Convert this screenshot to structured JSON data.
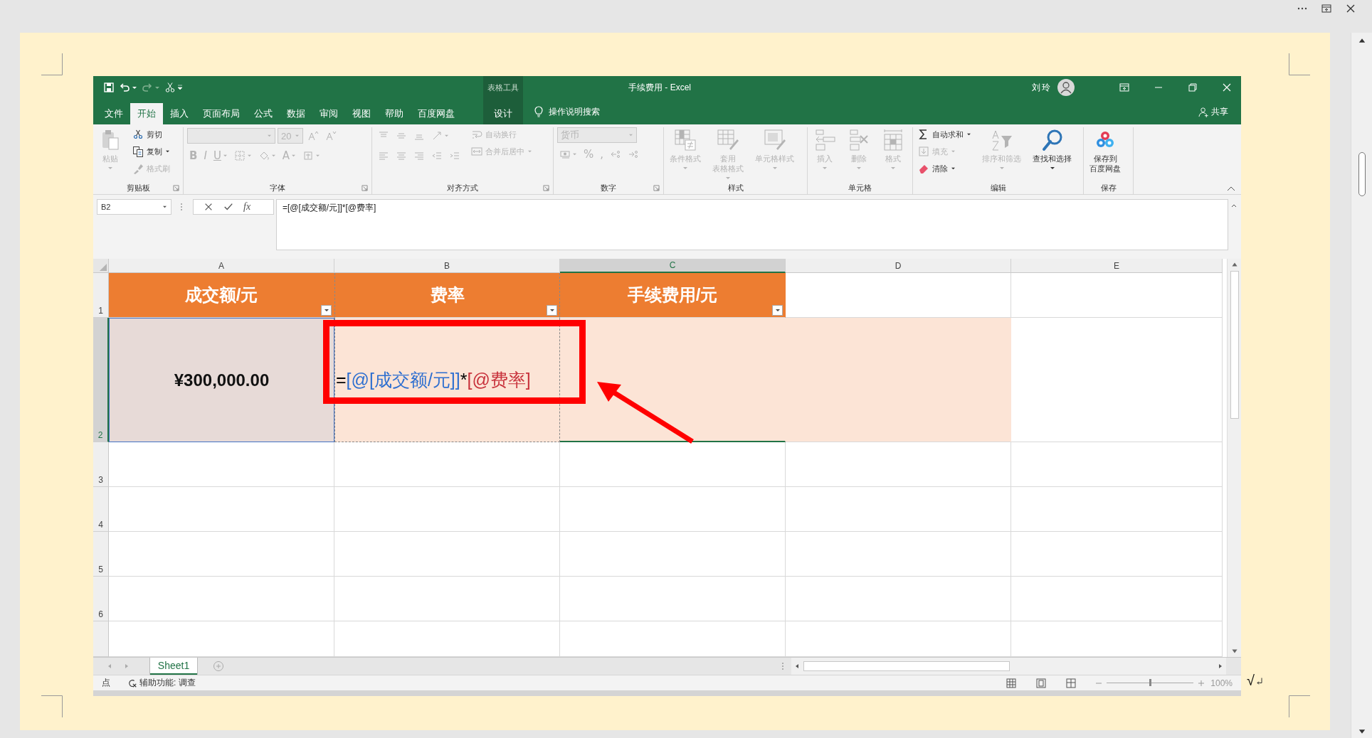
{
  "word": {
    "text_after_image": "√"
  },
  "excel": {
    "context_label": "表格工具",
    "title": "手续费用 - Excel",
    "user": "刘玲",
    "tabs": [
      {
        "label": "文件",
        "selected": false
      },
      {
        "label": "开始",
        "selected": true
      },
      {
        "label": "插入",
        "selected": false
      },
      {
        "label": "页面布局",
        "selected": false
      },
      {
        "label": "公式",
        "selected": false
      },
      {
        "label": "数据",
        "selected": false
      },
      {
        "label": "审阅",
        "selected": false
      },
      {
        "label": "视图",
        "selected": false
      },
      {
        "label": "帮助",
        "selected": false
      },
      {
        "label": "百度网盘",
        "selected": false
      }
    ],
    "context_tab": {
      "label": "设计",
      "selected": false
    },
    "tell_me": "操作说明搜索",
    "share": "共享",
    "ribbon_groups": [
      {
        "label": "剪贴板",
        "launcher": true,
        "columns": [
          [
            [
              {
                "kind": "large",
                "label": "粘贴",
                "disabled": true,
                "menu": true
              }
            ]
          ],
          [
            [
              {
                "kind": "small",
                "label": "剪切",
                "disabled": false,
                "menu": false
              }
            ],
            [
              {
                "kind": "small",
                "label": "复制",
                "disabled": false,
                "menu": true
              }
            ],
            [
              {
                "kind": "small",
                "label": "格式刷",
                "disabled": true,
                "menu": false
              }
            ]
          ]
        ]
      },
      {
        "label": "字体",
        "launcher": true,
        "columns": [
          [
            [
              {
                "kind": "combo",
                "disabled": true
              },
              {
                "kind": "combo",
                "value": "20",
                "disabled": true
              },
              {
                "kind": "tool",
                "disabled": true,
                "menu": false
              },
              {
                "kind": "tool",
                "disabled": true,
                "menu": false
              }
            ],
            [
              {
                "kind": "bold",
                "label": "B",
                "disabled": true,
                "menu": false
              },
              {
                "kind": "italic",
                "label": "I",
                "disabled": true,
                "menu": false
              },
              {
                "kind": "underline",
                "label": "U",
                "disabled": true,
                "menu": true
              },
              {
                "kind": "tool",
                "disabled": true,
                "menu": true
              },
              {
                "kind": "tool",
                "disabled": true,
                "menu": true
              },
              {
                "kind": "glyph",
                "label": "A",
                "disabled": true,
                "menu": true
              },
              {
                "kind": "tool",
                "disabled": true,
                "menu": true
              }
            ]
          ]
        ]
      },
      {
        "label": "对齐方式",
        "launcher": true,
        "columns": [
          [
            [
              {
                "kind": "tool",
                "disabled": true,
                "menu": false
              },
              {
                "kind": "tool",
                "disabled": true,
                "menu": false
              },
              {
                "kind": "tool",
                "disabled": true,
                "menu": false
              },
              {
                "kind": "tool",
                "disabled": true,
                "menu": true
              }
            ],
            [
              {
                "kind": "tool",
                "disabled": true,
                "menu": false
              },
              {
                "kind": "tool",
                "disabled": true,
                "menu": false
              },
              {
                "kind": "tool",
                "disabled": true,
                "menu": false
              },
              {
                "kind": "tool",
                "disabled": true,
                "menu": false
              },
              {
                "kind": "tool",
                "disabled": true,
                "menu": false
              }
            ]
          ],
          [
            [
              {
                "kind": "small",
                "label": "自动换行",
                "disabled": true,
                "menu": false
              }
            ],
            [
              {
                "kind": "small",
                "label": "合并后居中",
                "disabled": true,
                "menu": true
              }
            ]
          ]
        ]
      },
      {
        "label": "数字",
        "launcher": true,
        "columns": [
          [
            [
              {
                "kind": "combo",
                "value": "货币",
                "disabled": true
              }
            ],
            [
              {
                "kind": "tool",
                "disabled": true,
                "menu": true
              },
              {
                "kind": "glyph",
                "label": "%",
                "disabled": true,
                "menu": false
              },
              {
                "kind": "glyph",
                "label": ",",
                "disabled": true,
                "menu": false
              },
              {
                "kind": "tool",
                "disabled": true,
                "menu": false
              },
              {
                "kind": "tool",
                "disabled": true,
                "menu": false
              }
            ]
          ]
        ]
      },
      {
        "label": "样式",
        "launcher": false,
        "columns": [
          [
            [
              {
                "kind": "large",
                "label": "条件格式",
                "disabled": true,
                "menu": true
              }
            ]
          ],
          [
            [
              {
                "kind": "large",
                "lines": [
                  "套用",
                  "表格格式"
                ],
                "disabled": true,
                "menu": true
              }
            ]
          ],
          [
            [
              {
                "kind": "large",
                "label": "单元格样式",
                "disabled": true,
                "menu": true
              }
            ]
          ]
        ]
      },
      {
        "label": "单元格",
        "launcher": false,
        "columns": [
          [
            [
              {
                "kind": "large",
                "label": "插入",
                "disabled": true,
                "menu": true
              }
            ]
          ],
          [
            [
              {
                "kind": "large",
                "label": "删除",
                "disabled": true,
                "menu": true
              }
            ]
          ],
          [
            [
              {
                "kind": "large",
                "label": "格式",
                "disabled": true,
                "menu": true
              }
            ]
          ]
        ]
      },
      {
        "label": "编辑",
        "launcher": false,
        "columns": [
          [
            [
              {
                "kind": "small",
                "label": "自动求和",
                "disabled": false,
                "menu": true
              }
            ],
            [
              {
                "kind": "small",
                "label": "填充",
                "disabled": true,
                "menu": true
              }
            ],
            [
              {
                "kind": "small",
                "label": "清除",
                "disabled": false,
                "menu": true
              }
            ]
          ],
          [
            [
              {
                "kind": "large",
                "label": "排序和筛选",
                "disabled": true,
                "menu": true
              }
            ]
          ],
          [
            [
              {
                "kind": "large",
                "label": "查找和选择",
                "disabled": false,
                "menu": true
              }
            ]
          ]
        ]
      },
      {
        "label": "保存",
        "launcher": false,
        "columns": [
          [
            [
              {
                "kind": "large",
                "lines": [
                  "保存到",
                  "百度网盘"
                ],
                "disabled": false,
                "menu": false
              }
            ]
          ]
        ]
      }
    ],
    "formula_bar": {
      "name_box": "B2",
      "function_button": "fx",
      "formula": "=[@[成交额/元]]*[@费率]"
    },
    "sheet": {
      "columns": [
        {
          "label": "A",
          "selected": false
        },
        {
          "label": "B",
          "selected": false
        },
        {
          "label": "C",
          "selected": true
        },
        {
          "label": "D",
          "selected": false
        },
        {
          "label": "E",
          "selected": false
        }
      ],
      "rows": [
        {
          "label": "1",
          "selected": false
        },
        {
          "label": "2",
          "selected": true
        },
        {
          "label": "3",
          "selected": false
        },
        {
          "label": "4",
          "selected": false
        },
        {
          "label": "5",
          "selected": false
        },
        {
          "label": "6",
          "selected": false
        }
      ],
      "header_cells": [
        "成交额/元",
        "费率",
        "手续费用/元"
      ],
      "amount": "¥300,000.00",
      "formula_parts": [
        {
          "text": "=",
          "color": "#000000"
        },
        {
          "text": "[@[成交额/元]]",
          "color": "#2e6fd0"
        },
        {
          "text": "*",
          "color": "#000000"
        },
        {
          "text": "[@费率]",
          "color": "#c8323c"
        }
      ]
    },
    "sheet_tabs": [
      {
        "label": "Sheet1",
        "selected": true
      }
    ],
    "status": {
      "mode": "点",
      "accessibility": "辅助功能: 调查",
      "zoom": "100%",
      "level": 0.5
    }
  }
}
